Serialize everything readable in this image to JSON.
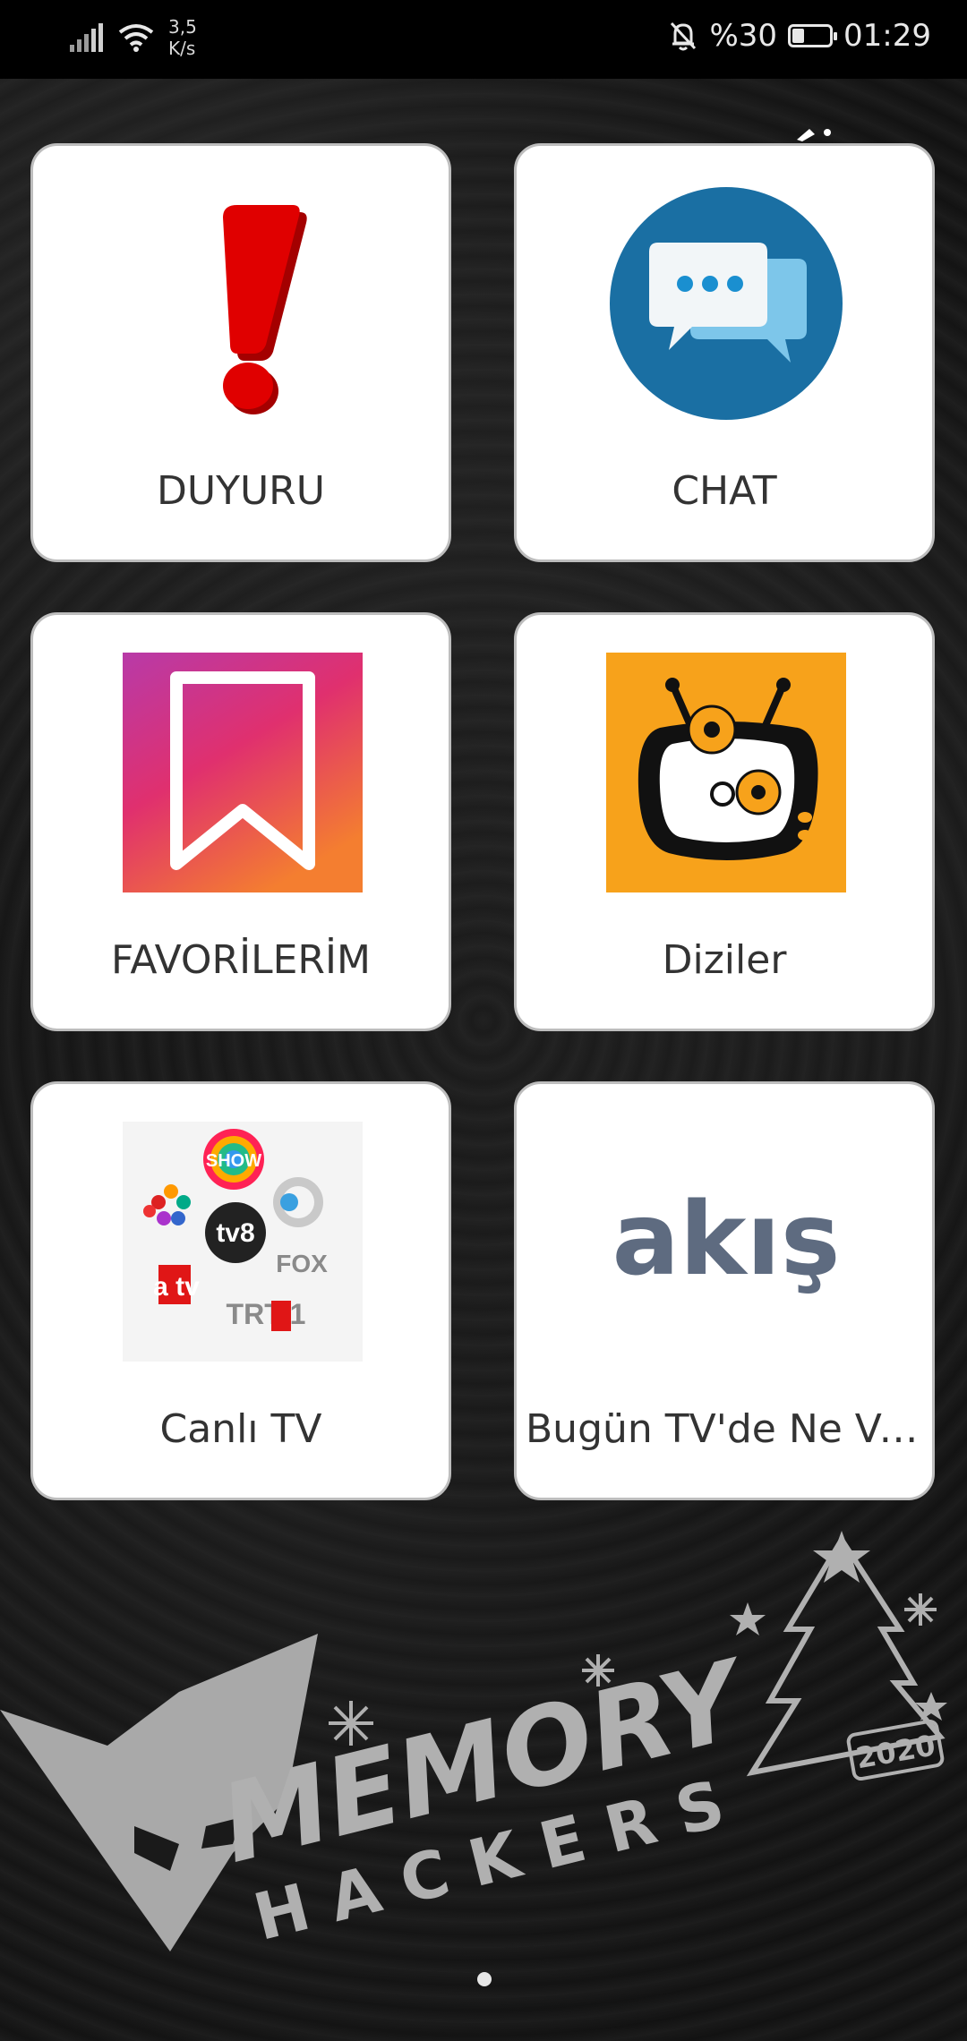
{
  "status_bar": {
    "network_speed_value": "3,5",
    "network_speed_unit": "K/s",
    "battery_label": "%30",
    "battery_level": 0.3,
    "time": "01:29"
  },
  "tiles": [
    {
      "label": "DUYURU",
      "icon": "exclamation-icon"
    },
    {
      "label": "CHAT",
      "icon": "chat-bubbles-icon"
    },
    {
      "label": "FAVORİLERİM",
      "icon": "bookmark-icon"
    },
    {
      "label": "Diziler",
      "icon": "tv-gears-icon"
    },
    {
      "label": "Canlı TV",
      "icon": "tv-channel-logos-icon"
    },
    {
      "label": "Bugün TV'de Ne Va...",
      "icon": "akis-logo-icon"
    }
  ],
  "icon_texts": {
    "akis": "akış",
    "show": "SHOW",
    "tv8": "tv8",
    "fox": "FOX",
    "atv": "a tv",
    "trt1": "TRT 1"
  },
  "brand": {
    "name": "MEMORY",
    "subname": "HACKERS",
    "year": "2020"
  },
  "colors": {
    "tile_bg": "#ffffff",
    "tile_border": "#bdbdbd",
    "label_text": "#333333",
    "chat_blue": "#1a6fa3",
    "tv_orange": "#f7a21b",
    "exclamation_red": "#e00000"
  }
}
